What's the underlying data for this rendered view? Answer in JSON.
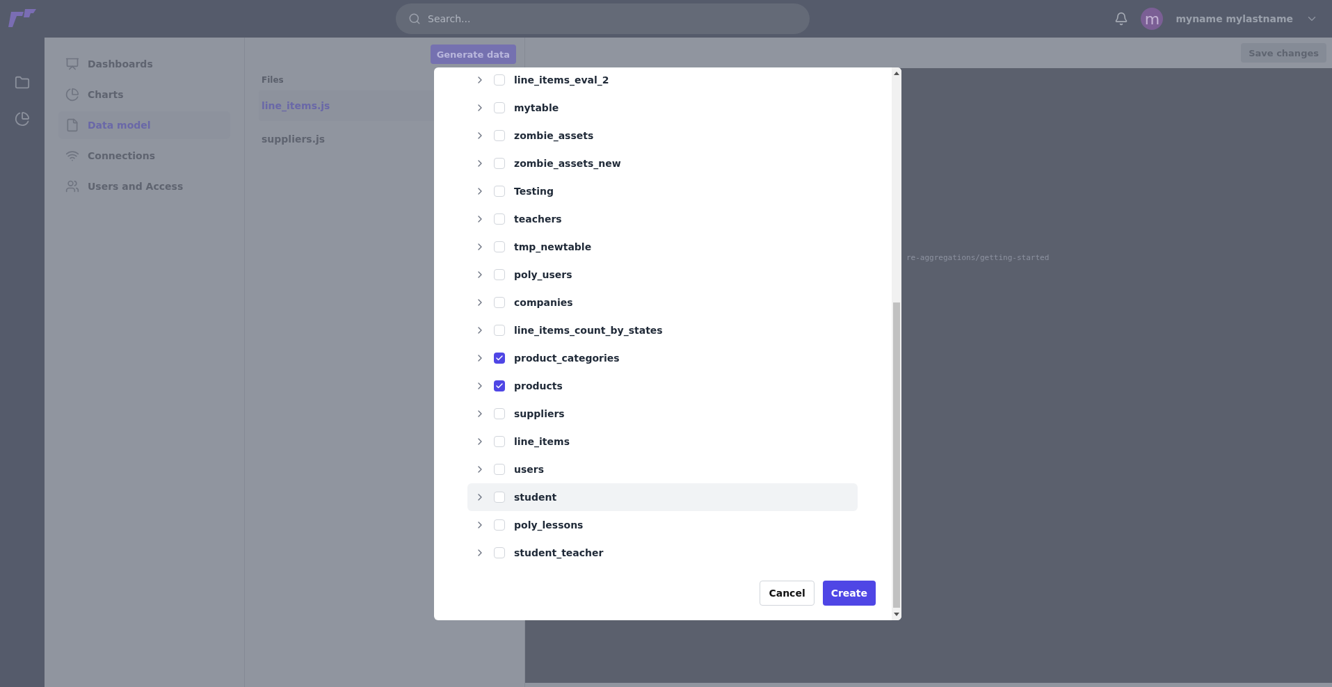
{
  "header": {
    "search": {
      "placeholder": "Search..."
    },
    "user": {
      "avatar_letter": "m",
      "name": "myname mylastname"
    }
  },
  "rail": [
    {
      "kind": "folder"
    },
    {
      "kind": "chart"
    }
  ],
  "sidebar": {
    "items": [
      {
        "label": "Dashboards",
        "selected": false
      },
      {
        "label": "Charts",
        "selected": false
      },
      {
        "label": "Data model",
        "selected": true
      },
      {
        "label": "Connections",
        "selected": false
      },
      {
        "label": "Users and Access",
        "selected": false
      }
    ]
  },
  "files": {
    "heading": "Files",
    "generate_button": "Generate data",
    "items": [
      {
        "label": "line_items.js",
        "selected": true
      },
      {
        "label": "suppliers.js",
        "selected": false
      }
    ]
  },
  "editor": {
    "save_button": "Save changes",
    "code_fragment": "re-aggregations/getting-started"
  },
  "modal": {
    "tables": [
      {
        "name": "line_items_eval_2",
        "checked": false,
        "hovered": false
      },
      {
        "name": "mytable",
        "checked": false,
        "hovered": false
      },
      {
        "name": "zombie_assets",
        "checked": false,
        "hovered": false
      },
      {
        "name": "zombie_assets_new",
        "checked": false,
        "hovered": false
      },
      {
        "name": "Testing",
        "checked": false,
        "hovered": false
      },
      {
        "name": "teachers",
        "checked": false,
        "hovered": false
      },
      {
        "name": "tmp_newtable",
        "checked": false,
        "hovered": false
      },
      {
        "name": "poly_users",
        "checked": false,
        "hovered": false
      },
      {
        "name": "companies",
        "checked": false,
        "hovered": false
      },
      {
        "name": "line_items_count_by_states",
        "checked": false,
        "hovered": false
      },
      {
        "name": "product_categories",
        "checked": true,
        "hovered": false
      },
      {
        "name": "products",
        "checked": true,
        "hovered": false
      },
      {
        "name": "suppliers",
        "checked": false,
        "hovered": false
      },
      {
        "name": "line_items",
        "checked": false,
        "hovered": false
      },
      {
        "name": "users",
        "checked": false,
        "hovered": false
      },
      {
        "name": "student",
        "checked": false,
        "hovered": true
      },
      {
        "name": "poly_lessons",
        "checked": false,
        "hovered": false
      },
      {
        "name": "student_teacher",
        "checked": false,
        "hovered": false
      }
    ],
    "buttons": [
      {
        "label": "Cancel",
        "kind": "secondary"
      },
      {
        "label": "Create",
        "kind": "primary"
      }
    ]
  }
}
